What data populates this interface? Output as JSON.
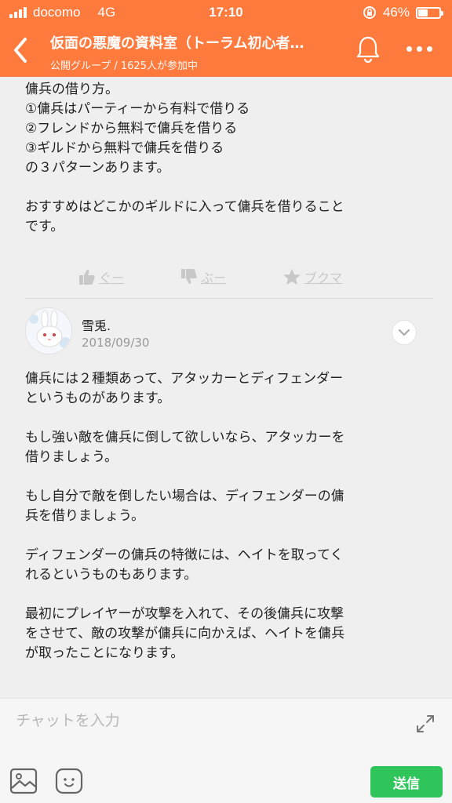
{
  "statusbar": {
    "carrier": "docomo",
    "network": "4G",
    "time": "17:10",
    "battery": "46%",
    "battery_level": 0.46
  },
  "header": {
    "title": "仮面の悪魔の資料室（トーラム初心者…",
    "subtitle": "公開グループ / 1625人が参加中",
    "icons": [
      "back-icon",
      "bell-icon",
      "more-icon"
    ]
  },
  "message1": {
    "lines": [
      "傭兵の借り方。",
      "①傭兵はパーティーから有料で借りる",
      "②フレンドから無料で傭兵を借りる",
      "③ギルドから無料で傭兵を借りる",
      "の３パターンあります。",
      "",
      "おすすめはどこかのギルドに入って傭兵を借りること",
      "です。"
    ],
    "actions": {
      "good": "ぐー",
      "bad": "ぶー",
      "bookmark": "ブクマ"
    }
  },
  "message2": {
    "author": "雪兎.",
    "date": "2018/09/30",
    "lines": [
      "傭兵には２種類あって、アタッカーとディフェンダー",
      "というものがあります。",
      "",
      "もし強い敵を傭兵に倒して欲しいなら、アタッカーを",
      "借りましょう。",
      "",
      "もし自分で敵を倒したい場合は、ディフェンダーの傭",
      "兵を借りましょう。",
      "",
      "ディフェンダーの傭兵の特徴には、ヘイトを取ってく",
      "れるというものもあります。",
      "",
      "最初にプレイヤーが攻撃を入れて、その後傭兵に攻撃",
      "をさせて、敵の攻撃が傭兵に向かえば、ヘイトを傭兵",
      "が取ったことになります。"
    ]
  },
  "composer": {
    "placeholder": "チャットを入力",
    "send_label": "送信",
    "send_color": "#2fc55a"
  },
  "colors": {
    "brand": "#ff7a3d"
  }
}
